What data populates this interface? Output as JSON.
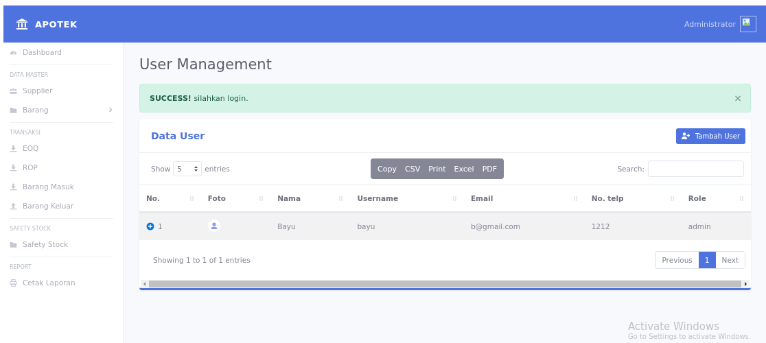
{
  "topbar": {
    "brand": "APOTEK",
    "user": "Administrator"
  },
  "sidebar": {
    "sections": [
      {
        "items": [
          {
            "label": "Dashboard"
          }
        ]
      },
      {
        "heading": "DATA MASTER",
        "items": [
          {
            "label": "Supplier"
          },
          {
            "label": "Barang",
            "expanded": false
          }
        ]
      },
      {
        "heading": "TRANSAKSI",
        "items": [
          {
            "label": "EOQ"
          },
          {
            "label": "ROP"
          },
          {
            "label": "Barang Masuk"
          },
          {
            "label": "Barang Keluar"
          }
        ]
      },
      {
        "heading": "SAFETY STOCK",
        "items": [
          {
            "label": "Safety Stock"
          }
        ]
      },
      {
        "heading": "REPORT",
        "items": [
          {
            "label": "Cetak Laporan"
          }
        ]
      }
    ]
  },
  "page_title": "User Management",
  "alert": {
    "strong": "SUCCESS!",
    "text": "silahkan login.",
    "close": "×"
  },
  "card": {
    "title": "Data User",
    "add_button": "Tambah User",
    "length": {
      "before": "Show",
      "value": "5",
      "after": "entries"
    },
    "export_buttons": [
      "Copy",
      "CSV",
      "Print",
      "Excel",
      "PDF"
    ],
    "search": {
      "label": "Search:"
    },
    "table": {
      "columns": [
        "No.",
        "Foto",
        "Nama",
        "Username",
        "Email",
        "No. telp",
        "Role"
      ],
      "rows": [
        {
          "expanded": false,
          "cells": [
            "1",
            null,
            "Bayu",
            "bayu",
            "b@gmail.com",
            "1212",
            "admin"
          ]
        }
      ]
    },
    "info": "Showing 1 to 1 of 1 entries",
    "pagination": [
      {
        "label": "Previous",
        "selected": false
      },
      {
        "label": "1",
        "selected": true
      },
      {
        "label": "Next",
        "selected": false
      }
    ]
  },
  "os_notice": {
    "title": "Activate Windows",
    "text": "Go to Settings to activate Windows."
  }
}
